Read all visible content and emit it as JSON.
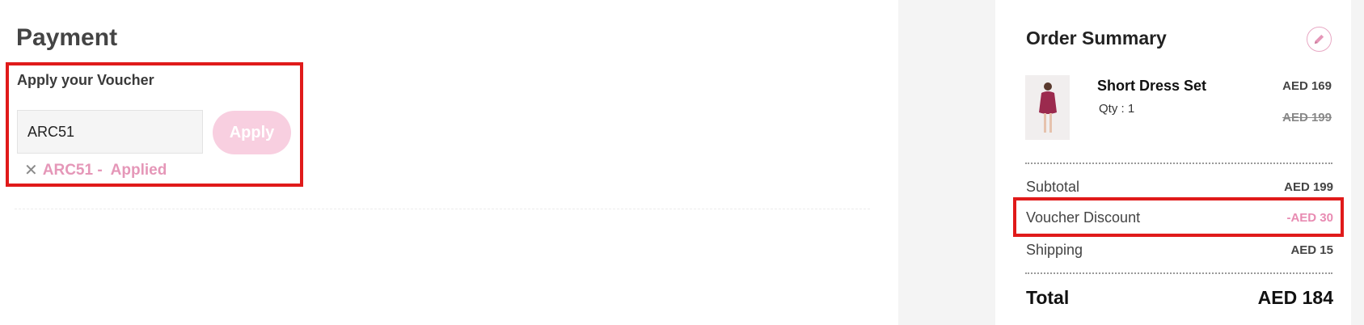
{
  "payment": {
    "title": "Payment",
    "voucher_heading": "Apply your Voucher",
    "voucher_input_value": "ARC51",
    "apply_label": "Apply",
    "applied_code": "ARC51 -",
    "applied_status": "Applied",
    "remove_icon": "close-icon"
  },
  "summary": {
    "title": "Order Summary",
    "edit_icon": "pencil-icon",
    "product": {
      "name": "Short Dress Set",
      "qty": "Qty : 1",
      "price_now": "AED 169",
      "price_old": "AED 199"
    },
    "rows": [
      {
        "label": "Subtotal",
        "value": "AED 199"
      },
      {
        "label": "Voucher Discount",
        "value": "-AED 30"
      },
      {
        "label": "Shipping",
        "value": "AED 15"
      }
    ],
    "total_label": "Total",
    "total_value": "AED 184"
  },
  "colors": {
    "accent_pink": "#e88bb2",
    "apply_button_bg": "#f8cfe0",
    "highlight_red": "#e01a1a"
  }
}
